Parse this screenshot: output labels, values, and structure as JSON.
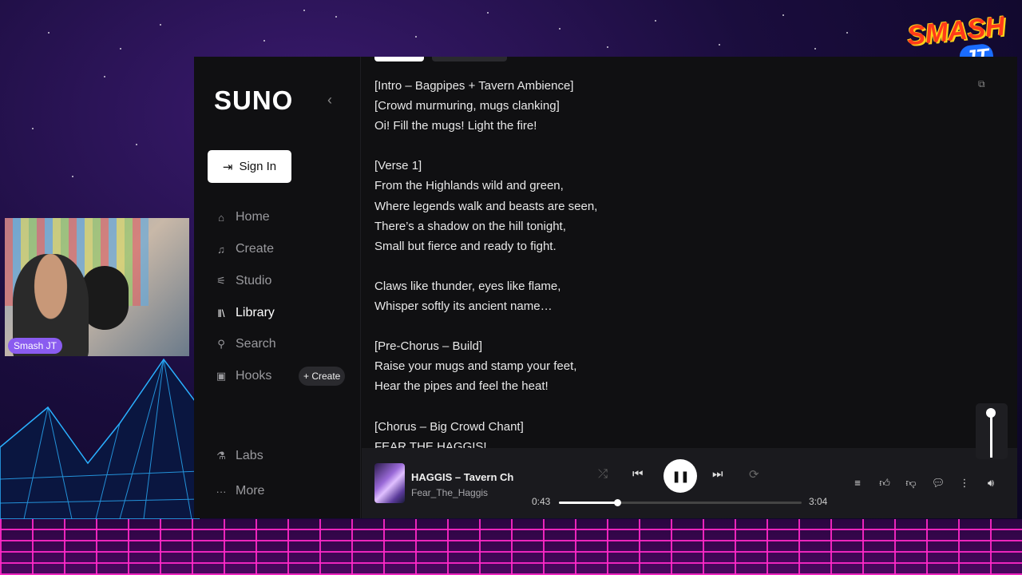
{
  "overlay": {
    "logo_line1": "SMASH",
    "logo_line2": "JT",
    "webcam_name": "Smash JT"
  },
  "app": {
    "logo": "SUNO",
    "sign_in_label": "Sign In",
    "nav": [
      {
        "label": "Home",
        "icon": "home-icon"
      },
      {
        "label": "Create",
        "icon": "music-note-icon"
      },
      {
        "label": "Studio",
        "icon": "studio-icon"
      },
      {
        "label": "Library",
        "icon": "library-icon",
        "active": true
      },
      {
        "label": "Search",
        "icon": "search-icon"
      },
      {
        "label": "Hooks",
        "icon": "hooks-icon"
      },
      {
        "label": "Labs",
        "icon": "flask-icon"
      },
      {
        "label": "More",
        "icon": "more-icon"
      }
    ],
    "hooks_create_label": "+ Create"
  },
  "lyrics": [
    "[Intro – Bagpipes + Tavern Ambience]",
    "[Crowd murmuring, mugs clanking]",
    "Oi! Fill the mugs! Light the fire!",
    "",
    "[Verse 1]",
    "From the Highlands wild and green,",
    "Where legends walk and beasts are seen,",
    "There’s a shadow on the hill tonight,",
    "Small but fierce and ready to fight.",
    "",
    "Claws like thunder, eyes like flame,",
    "Whisper softly its ancient name…",
    "",
    "[Pre-Chorus – Build]",
    "Raise your mugs and stamp your feet,",
    "Hear the pipes and feel the heat!",
    "",
    "[Chorus – Big Crowd Chant]",
    "FEAR THE HAGGIS!"
  ],
  "player": {
    "title": "HAGGIS – Tavern Ch",
    "artist": "Fear_The_Haggis",
    "elapsed": "0:43",
    "duration": "3:04",
    "progress_fraction": 0.24,
    "volume_fraction": 1.0
  }
}
